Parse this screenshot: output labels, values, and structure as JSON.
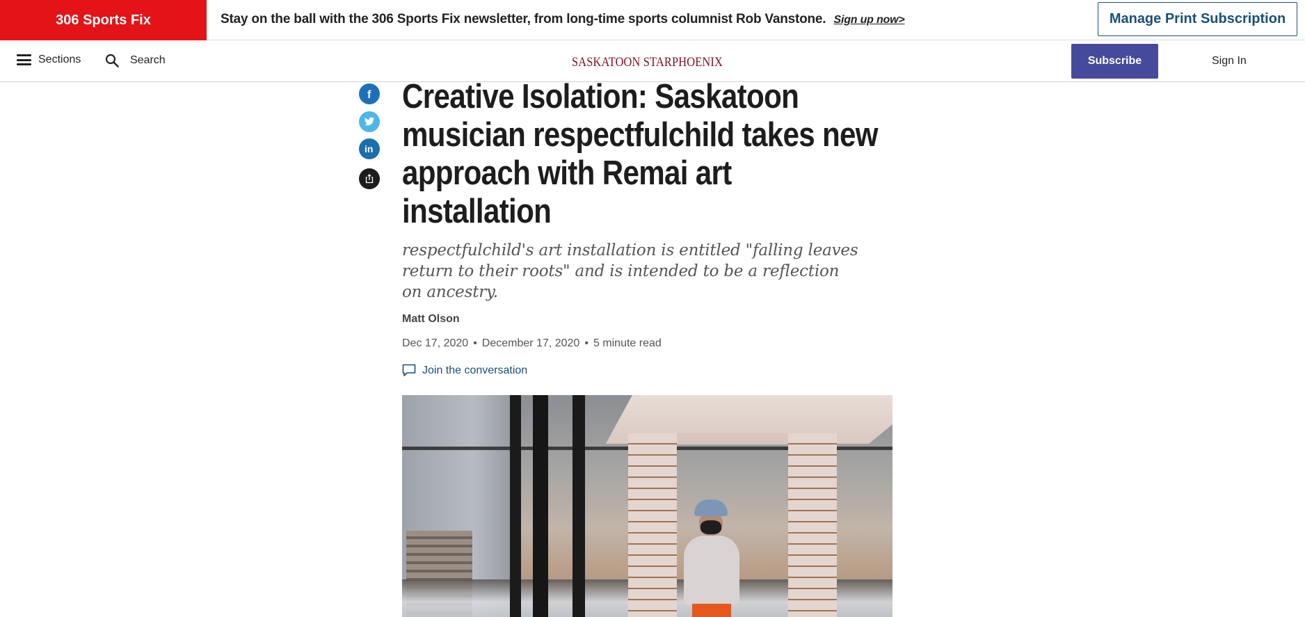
{
  "promo": {
    "badge": "306 Sports Fix",
    "text": "Stay on the ball with the 306 Sports Fix newsletter, from long-time sports columnist Rob Vanstone.",
    "link": "Sign up now>",
    "manage_button": "Manage Print Subscription"
  },
  "nav": {
    "sections_label": "Sections",
    "search_label": "Search",
    "logo": "Saskatoon StarPhoenix",
    "subscribe_label": "Subscribe",
    "signin_label": "Sign In"
  },
  "share": {
    "icons": [
      "facebook-icon",
      "twitter-icon",
      "linkedin-icon",
      "share-icon"
    ],
    "colors": {
      "facebook": "#1d70b8",
      "twitter": "#4fb6e8",
      "linkedin": "#1a6fae",
      "share": "#1c1c1c"
    }
  },
  "article": {
    "headline": "Creative Isolation: Saskatoon musician respectfulchild takes new approach with Remai art installation",
    "dek": "respectfulchild's art installation is entitled \"falling leaves return to their roots\" and is intended to be a reflection on ancestry.",
    "author": "Matt Olson",
    "published": "Dec 17, 2020",
    "updated": "December 17, 2020",
    "read_time": "5 minute read",
    "conversation": "Join the conversation"
  },
  "colors": {
    "promo_red": "#e31318",
    "brand_blue": "#1a4f7a",
    "subscribe_purple": "#454a9c",
    "logo_maroon": "#7a1020"
  }
}
